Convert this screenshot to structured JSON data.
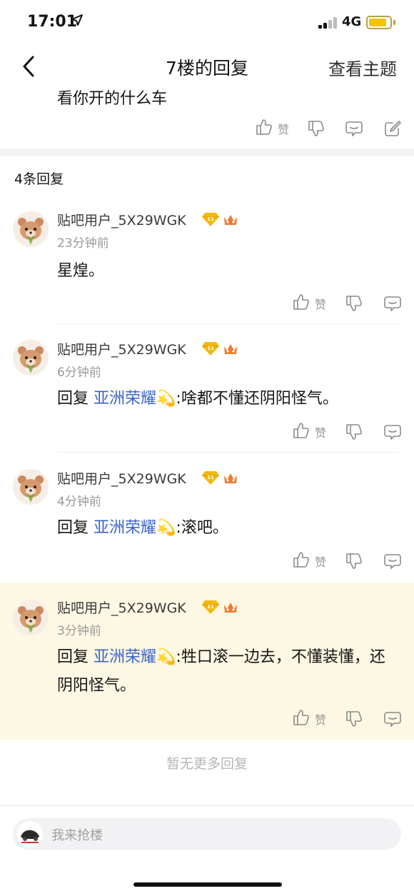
{
  "status_bar": {
    "time": "17:01",
    "location_icon": "location-arrow-icon",
    "network": "4G",
    "battery_color": "#f4c400"
  },
  "nav": {
    "back_icon": "chevron-left-icon",
    "title": "7楼的回复",
    "topic_link": "查看主题"
  },
  "main_post": {
    "text": "看你开的什么车",
    "actions": {
      "like_label": "赞",
      "icons": [
        "thumbs-up-icon",
        "thumbs-down-icon",
        "comment-icon",
        "share-icon"
      ]
    }
  },
  "reply_count": "4条回复",
  "replies": [
    {
      "username": "贴吧用户_5X29WGK",
      "level": "11",
      "time": "23分钟前",
      "prefix": "",
      "mention": "",
      "mention_emoji": "",
      "text": "星煌。",
      "like_label": "赞"
    },
    {
      "username": "贴吧用户_5X29WGK",
      "level": "11",
      "time": "6分钟前",
      "prefix": "回复 ",
      "mention": "亚洲荣耀",
      "mention_emoji": "💫",
      "text": ":啥都不懂还阴阳怪气。",
      "like_label": "赞"
    },
    {
      "username": "贴吧用户_5X29WGK",
      "level": "11",
      "time": "4分钟前",
      "prefix": "回复 ",
      "mention": "亚洲荣耀",
      "mention_emoji": "💫",
      "text": ":滚吧。",
      "like_label": "赞"
    },
    {
      "username": "贴吧用户_5X29WGK",
      "level": "11",
      "time": "3分钟前",
      "prefix": "回复 ",
      "mention": "亚洲荣耀",
      "mention_emoji": "💫",
      "text": ":牲口滚一边去，不懂装懂，还阴阳怪气。",
      "like_label": "赞"
    }
  ],
  "footer": {
    "no_more": "暂无更多回复",
    "input_placeholder": "我来抢楼"
  },
  "colors": {
    "mention": "#3b63c4",
    "highlight_bg": "#fdf8e4",
    "badge_gold": "#f2b90c",
    "badge_crown": "#f07b2c"
  }
}
